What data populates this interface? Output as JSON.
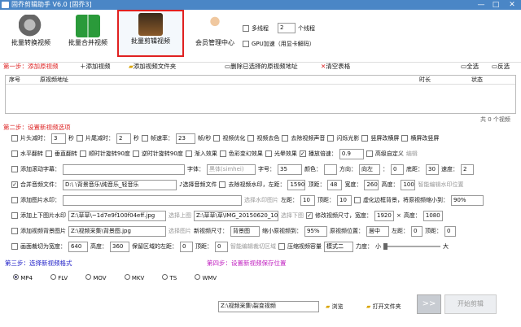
{
  "window": {
    "title": "固乔剪辑助手 V6.0    [固乔3]",
    "min": "—",
    "max": "□",
    "close": "✕"
  },
  "toolbar": {
    "btn1": "批量转换视频",
    "btn2": "批量合并视频",
    "btn3": "批量剪辑视频",
    "btn4": "会员管理中心",
    "multithread_label": "多线程",
    "thread_count": "2",
    "thread_unit": "个线程",
    "gpu_label": "GPU加速（用显卡解码）"
  },
  "step1": {
    "label": "第一步：添加原视频",
    "add_video": "添加视频",
    "add_folder": "添加视频文件夹",
    "remove_selected": "删除已选择的原视频地址",
    "clear": "清空表格",
    "select_all": "全选",
    "invert": "反选"
  },
  "table": {
    "col_index": "序号",
    "col_path": "原视频地址",
    "col_duration": "时长",
    "col_status": "状态"
  },
  "count_text": "共 0 个视频",
  "step2": {
    "label": "第二步：设置新视频选项",
    "r1": {
      "cut_head": "片头减时：",
      "head_val": "3",
      "sec1": "秒",
      "cut_tail": "片尾减时：",
      "tail_val": "2",
      "sec2": "秒",
      "framerate": "帧速率：",
      "fr_val": "23",
      "fps": "帧/秒",
      "optimize": "视频优化",
      "decolor": "视频去色",
      "remove_audio": "去除视频声音",
      "flicker": "闪烁光影",
      "vertical": "竖屏改横屏",
      "horizontal": "横屏改竖屏"
    },
    "r2": {
      "hflip": "水平翻转",
      "vflip": "垂直翻转",
      "cw": "顺时针旋转90度",
      "ccw": "逆时针旋转90度",
      "fade": "渐入效果",
      "color": "色彩变幻效果",
      "light": "光晕效果",
      "speed": "播放倍速：",
      "speed_val": "0.9",
      "custom": "高级自定义",
      "edit": "编辑"
    },
    "r3": {
      "subtitle": "添加滚动字幕：",
      "font": "字体：",
      "font_val": "黑体(simhei)",
      "size": "字号：",
      "size_val": "35",
      "color": "颜色：",
      "direction": "方向：",
      "dir_val": "向左",
      "offset": "：",
      "offset_val": "0",
      "bottom": "底距：",
      "bottom_val": "30",
      "speed": "速度：",
      "speed_val": "2"
    },
    "r4": {
      "audio": "合并音频文件：",
      "audio_path": "D:\\              \\背景音乐\\纯音乐_轻音乐",
      "choose_audio": "选择音频文件",
      "wm": "去除视频水印，左距：",
      "left": "1590",
      "top_l": "顶距：",
      "top": "48",
      "w_l": "宽度：",
      "w": "260",
      "h_l": "高度：",
      "h": "100",
      "smart": "智能编辑水印位置"
    },
    "r5": {
      "img_wm": "添加图片水印：",
      "choose_img": "选择水印图片",
      "left_l": "左距：",
      "left": "10",
      "top_l": "顶距：",
      "top": "10",
      "blur": "虚化边框背景，将原视频缩小到：",
      "blur_val": "90%"
    },
    "r6": {
      "topbottom": "添加上下图片水印",
      "top_path": "Z:\\草草\\~1d7e9f100f04eff.jpg",
      "choose_top": "选择上图",
      "bottom_path": "Z:\\草草\\草\\IMG_20150620_104",
      "choose_bottom": "选择下图",
      "resize": "修改视频尺寸，宽度：",
      "width": "1920",
      "x": "×",
      "height_l": "高度：",
      "height": "1080"
    },
    "r7": {
      "bg": "添加视频背景图片",
      "bg_path": "Z:\\视频采集\\背景图.jpg",
      "choose_img": "选择图片",
      "size_l": "新视频尺寸：",
      "size_val": "背景图",
      "shrink": "缩小原视频到：",
      "shrink_val": "95%",
      "pos": "原视频位置：",
      "pos_val": "居中",
      "left_l": "左距：",
      "left": "0",
      "top_l": "顶距：",
      "top": "0"
    },
    "r8": {
      "crop": "画面裁切为宽度：",
      "w": "640",
      "h_l": "高度：",
      "h": "360",
      "keep": "保留区域的左距：",
      "left": "0",
      "top_l": "顶距：",
      "top": "0",
      "smart": "智能编辑裁切区域",
      "compress": "压缩视频容量",
      "mode": "模式二",
      "strength": "力度：",
      "small": "小",
      "big": "大"
    }
  },
  "step3": {
    "label": "第三步：选择新视频格式",
    "formats": [
      "MP4",
      "FLV",
      "MOV",
      "MKV",
      "TS",
      "WMV"
    ],
    "selected": "MP4"
  },
  "step4": {
    "label": "第四步：设置新视频保存位置",
    "path": "Z:\\视频采集\\裂变视频",
    "browse": "浏览",
    "open": "打开文件夹",
    "start": "开始剪辑",
    "arrow": ">>"
  }
}
